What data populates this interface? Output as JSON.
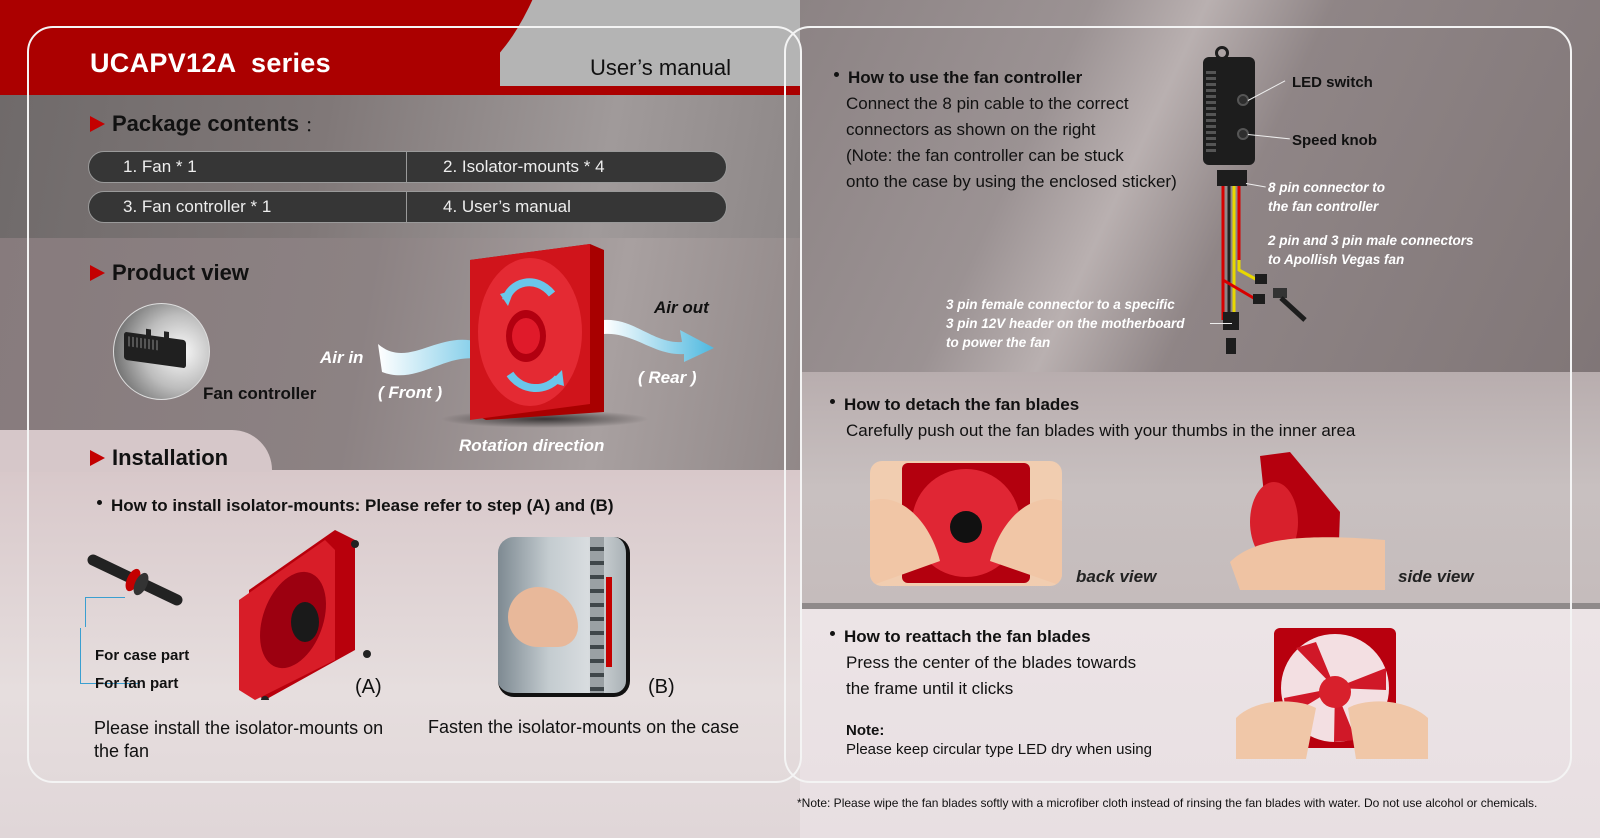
{
  "header": {
    "series_title": "UCAPV12A  series",
    "manual_label": "User’s manual"
  },
  "colors": {
    "brand_red": "#ab0000",
    "accent_chevron": "#c40000",
    "callout_blue": "#3a9fd0",
    "pill_dark": "#363636"
  },
  "package": {
    "heading": "Package contents",
    "colon": "：",
    "items": [
      {
        "label": "1.  Fan * 1"
      },
      {
        "label": "2.  Isolator-mounts * 4"
      },
      {
        "label": "3.  Fan controller * 1"
      },
      {
        "label": "4.  User’s manual"
      }
    ]
  },
  "product_view": {
    "heading": "Product view",
    "fan_controller_label": "Fan controller",
    "air_in": "Air in",
    "front": "( Front )",
    "air_out": "Air out",
    "rear": "( Rear )",
    "rotation": "Rotation direction"
  },
  "installation": {
    "heading": "Installation",
    "bullet": "How to install isolator-mounts: Please refer to step (A) and (B)",
    "for_case_part": "For case part",
    "for_fan_part": "For fan part",
    "step_a": "(A)",
    "step_b": "(B)",
    "caption_a": "Please install the isolator-mounts on the fan",
    "caption_b": "Fasten the isolator-mounts on the case"
  },
  "fan_controller_usage": {
    "bullet": "How to use the fan controller",
    "lines": [
      "Connect the 8 pin cable to the correct",
      "connectors as shown on the right",
      "(Note: the fan controller can be stuck",
      "onto the case by using the enclosed sticker)"
    ],
    "led_switch": "LED switch",
    "speed_knob": "Speed knob",
    "pin8_lines": [
      "8 pin connector to",
      "the fan controller"
    ],
    "pin23_lines": [
      "2 pin and 3 pin male connectors",
      "to Apollish Vegas fan"
    ],
    "pin3f_lines": [
      "3 pin female connector to a specific",
      "3 pin 12V header on the motherboard",
      "to power the fan"
    ]
  },
  "detach": {
    "bullet": "How to detach the fan blades",
    "body": "Carefully push out the fan blades with your thumbs in the inner area",
    "back_view": "back view",
    "side_view": "side view"
  },
  "reattach": {
    "bullet": "How to reattach the fan blades",
    "lines": [
      "Press the center of the blades towards",
      "the frame until it clicks"
    ],
    "note_head": "Note:",
    "note_body": "Please keep circular type LED dry when using"
  },
  "footnote": "*Note: Please wipe the fan blades softly with a microfiber cloth instead of rinsing the fan blades with water. Do not use alcohol or chemicals."
}
